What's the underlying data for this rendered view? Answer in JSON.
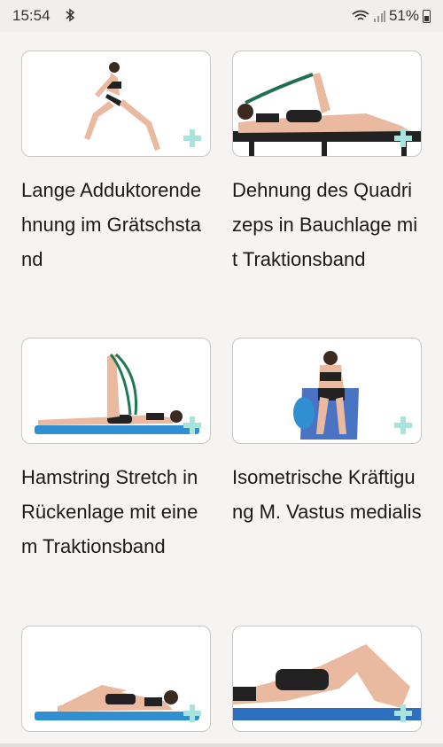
{
  "status": {
    "time": "15:54",
    "battery": "51%"
  },
  "exercises": [
    {
      "title": "Lange Adduktorendehnung im Grätschstand"
    },
    {
      "title": "Dehnung des Quadrizeps in Bauchlage mit Traktionsband"
    },
    {
      "title": "Hamstring Stretch in Rückenlage mit einem Traktionsband"
    },
    {
      "title": "Isometrische Kräftigung M. Vastus medialis"
    },
    {
      "title": ""
    },
    {
      "title": ""
    }
  ],
  "colors": {
    "plus": "#a8e3dc",
    "mat": "#2f8fd0"
  }
}
